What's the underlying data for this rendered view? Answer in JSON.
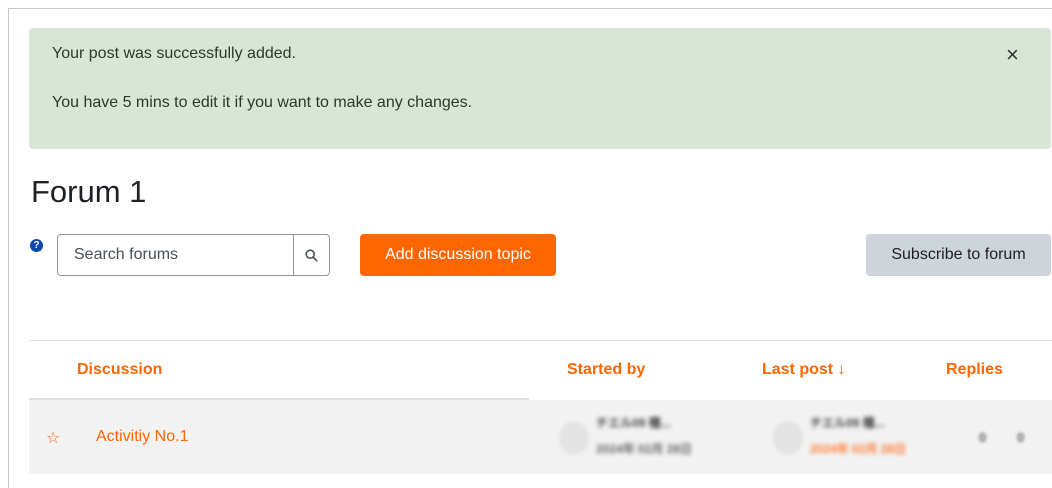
{
  "alert": {
    "message": "Your post was successfully added.",
    "detail": "You have 5 mins to edit it if you want to make any changes.",
    "close_glyph": "×"
  },
  "forum": {
    "title": "Forum 1"
  },
  "search": {
    "placeholder": "Search forums",
    "help_icon": "question-circle-icon",
    "button_icon": "search-icon"
  },
  "actions": {
    "add_discussion": "Add discussion topic",
    "subscribe": "Subscribe to forum"
  },
  "table": {
    "headers": {
      "discussion": "Discussion",
      "started_by": "Started by",
      "last_post": "Last post ↓",
      "replies": "Replies"
    },
    "rows": [
      {
        "star_glyph": "☆",
        "title": "Activitiy No.1",
        "started_by_name": "チエル09 種...",
        "started_by_date": "2024年 02月 28日",
        "last_post_name": "チエル09 種...",
        "last_post_date": "2024年 02月 28日",
        "replies": "0",
        "unread": "0"
      }
    ]
  },
  "colors": {
    "accent": "#ff6600",
    "alert_bg": "#d8e6d6",
    "secondary_btn": "#ced4da",
    "help_icon": "#0f47ad"
  }
}
